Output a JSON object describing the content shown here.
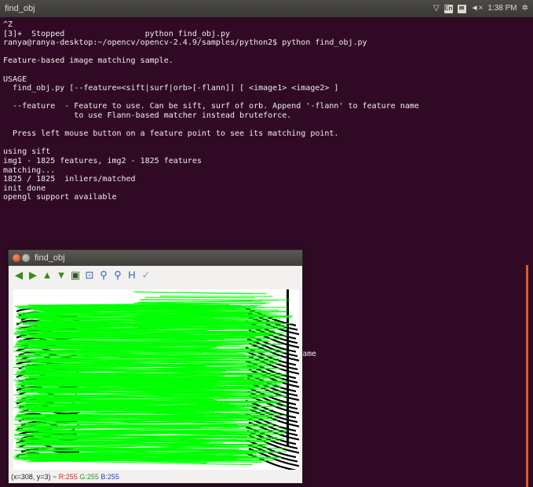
{
  "top_panel": {
    "app_title": "find_obj",
    "keyboard_layout": "En",
    "volume_label": "◄×",
    "clock": "1:38 PM",
    "icons": [
      "wifi-icon",
      "keyboard-indicator",
      "mail-icon",
      "volume-icon",
      "settings-gear-icon"
    ]
  },
  "terminal": {
    "lines": [
      "^Z",
      "[3]+  Stopped                 python find_obj.py",
      "ranya@ranya-desktop:~/opencv/opencv-2.4.9/samples/python2$ python find_obj.py",
      "",
      "Feature-based image matching sample.",
      "",
      "USAGE",
      "  find_obj.py [--feature=<sift|surf|orb>[-flann]] [ <image1> <image2> ]",
      "",
      "  --feature  - Feature to use. Can be sift, surf of orb. Append '-flann' to feature name",
      "               to use Flann-based matcher instead bruteforce.",
      "",
      "  Press left mouse button on a feature point to see its matching point.",
      "",
      "using sift",
      "img1 - 1825 features, img2 - 1825 features",
      "matching...",
      "1825 / 1825  inliers/matched",
      "init done",
      "opengl support available"
    ],
    "partial_text": "ame",
    "accent_color": "#e05a26",
    "background_color": "#300a24"
  },
  "opencv_window": {
    "title": "find_obj",
    "toolbar": [
      {
        "name": "pan-left-icon",
        "glyph": "◀"
      },
      {
        "name": "pan-right-icon",
        "glyph": "▶"
      },
      {
        "name": "pan-up-icon",
        "glyph": "▲"
      },
      {
        "name": "pan-down-icon",
        "glyph": "▼"
      },
      {
        "name": "zoom-reset-icon",
        "glyph": "▣"
      },
      {
        "name": "zoom-fit-icon",
        "glyph": "⊡"
      },
      {
        "name": "zoom-in-icon",
        "glyph": "⚲"
      },
      {
        "name": "zoom-out-icon",
        "glyph": "⚲"
      },
      {
        "name": "save-icon",
        "glyph": "H"
      },
      {
        "name": "properties-icon",
        "glyph": "✓"
      }
    ],
    "status": {
      "coords": "(x=308, y=3) ~ ",
      "r": "R:255",
      "g": "G:255",
      "b": "B:255"
    },
    "match_line_color": "#00ff00"
  }
}
